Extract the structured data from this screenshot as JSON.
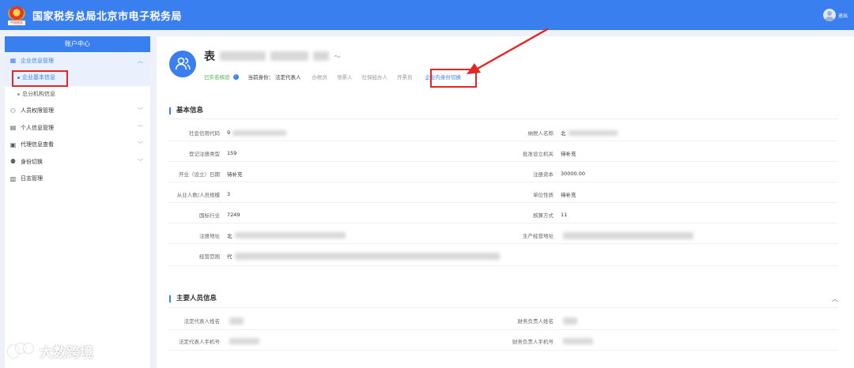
{
  "header": {
    "title": "国家税务总局北京市电子税务局",
    "logo_text": "中国税务",
    "user_label": "退出"
  },
  "sidebar": {
    "title": "账户中心",
    "groups": [
      {
        "label": "企业信息管理",
        "icon": "building-icon",
        "expanded": true,
        "children": [
          {
            "label": "企业基本信息",
            "active": true
          },
          {
            "label": "总分机构信息",
            "active": false
          }
        ]
      },
      {
        "label": "人员权限管理",
        "icon": "people-lock-icon"
      },
      {
        "label": "个人信息管理",
        "icon": "id-card-icon"
      },
      {
        "label": "代理信息查看",
        "icon": "agent-icon"
      },
      {
        "label": "身份切换",
        "icon": "switch-user-icon"
      },
      {
        "label": "日志管理",
        "icon": "log-icon"
      }
    ]
  },
  "profile": {
    "name_prefix": "表",
    "verified": "已实名核验",
    "identity_label": "当前身份：",
    "identity_value": "法定代表人",
    "roles": [
      "办税员",
      "领票人",
      "社保经办人",
      "开票员"
    ],
    "switch_label": "企业内身份切换"
  },
  "basic_info": {
    "title": "基本信息",
    "left": [
      {
        "label": "社会信用代码",
        "value": "9"
      },
      {
        "label": "登记注册类型",
        "value": "159"
      },
      {
        "label": "开业（设立）日期",
        "value": "待补充"
      },
      {
        "label": "从业人数/人员规模",
        "value": "3"
      },
      {
        "label": "国标行业",
        "value": "7249"
      },
      {
        "label": "注册地址",
        "value": "北"
      },
      {
        "label": "经营范围",
        "value": "代"
      }
    ],
    "right": [
      {
        "label": "纳税人名称",
        "value": "北"
      },
      {
        "label": "批准设立机关",
        "value": "待补充"
      },
      {
        "label": "注册资本",
        "value": "30000.00"
      },
      {
        "label": "单位性质",
        "value": "待补充"
      },
      {
        "label": "核算方式",
        "value": "11"
      },
      {
        "label": "生产经营地址",
        "value": ""
      }
    ]
  },
  "key_personnel": {
    "title": "主要人员信息",
    "left": [
      {
        "label": "法定代表人姓名",
        "value": ""
      },
      {
        "label": "法定代表人手机号",
        "value": ""
      }
    ],
    "right": [
      {
        "label": "财务负责人姓名",
        "value": ""
      },
      {
        "label": "财务负责人手机号",
        "value": ""
      }
    ]
  },
  "watermark": {
    "text": "大数跨境"
  }
}
